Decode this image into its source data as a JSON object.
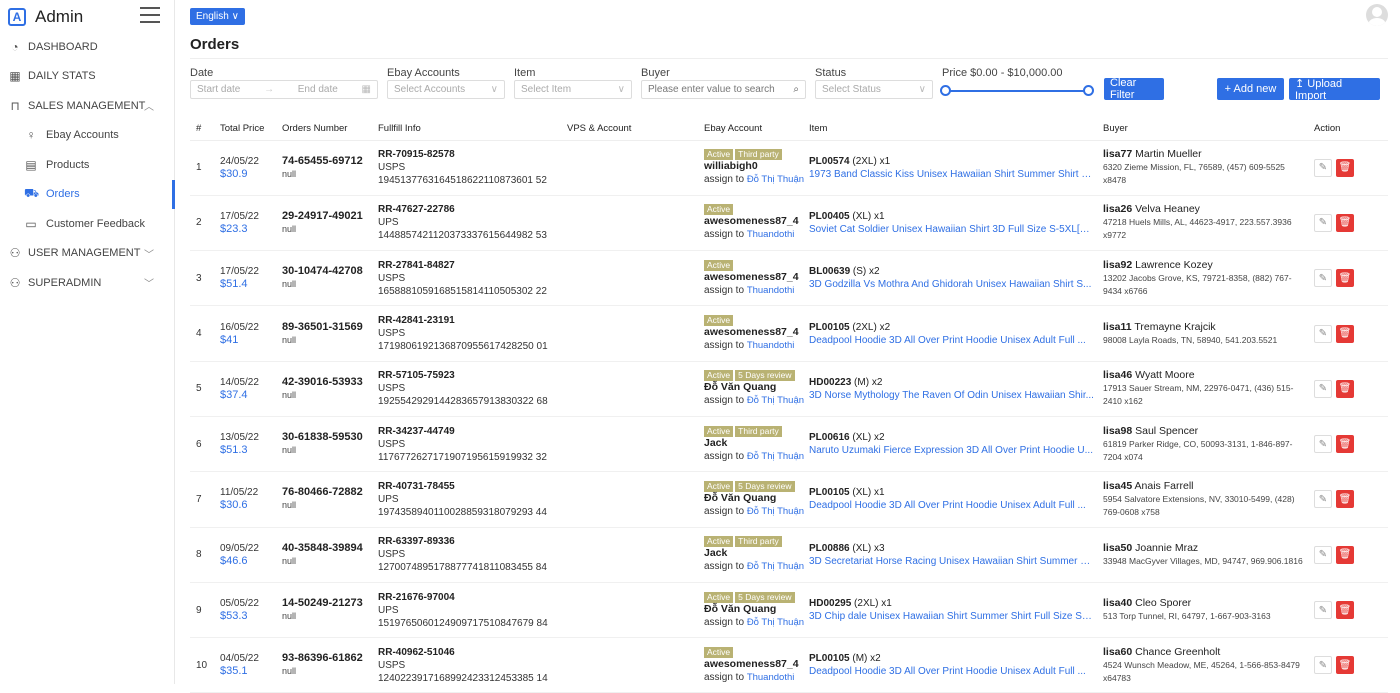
{
  "sidebar": {
    "brand": "Admin",
    "items": [
      {
        "label": "DASHBOARD",
        "icon": "speedometer-icon"
      },
      {
        "label": "DAILY STATS",
        "icon": "calendar-icon"
      },
      {
        "label": "SALES MANAGEMENT",
        "icon": "bag-icon"
      },
      {
        "label": "Ebay Accounts",
        "icon": "person-icon"
      },
      {
        "label": "Products",
        "icon": "products-icon"
      },
      {
        "label": "Orders",
        "icon": "cart-icon"
      },
      {
        "label": "Customer Feedback",
        "icon": "feedback-icon"
      },
      {
        "label": "USER MANAGEMENT",
        "icon": "users-icon"
      },
      {
        "label": "SUPERADMIN",
        "icon": "admin-icon"
      }
    ]
  },
  "header": {
    "language": "English ∨"
  },
  "page": {
    "title": "Orders"
  },
  "filters": {
    "date_label": "Date",
    "start_placeholder": "Start date",
    "end_placeholder": "End date",
    "accounts_label": "Ebay Accounts",
    "accounts_placeholder": "Select Accounts",
    "item_label": "Item",
    "item_placeholder": "Select Item",
    "buyer_label": "Buyer",
    "buyer_placeholder": "Please enter value to search",
    "status_label": "Status",
    "status_placeholder": "Select Status",
    "price_label": "Price",
    "price_range": "$0.00 - $10,000.00",
    "clear_label": "Clear Filter",
    "add_label": "+ Add new",
    "upload_label": "↥ Upload Import"
  },
  "table": {
    "headers": [
      "#",
      "Total Price",
      "Orders Number",
      "Fullfill Info",
      "VPS & Account",
      "Ebay Account",
      "Item",
      "Buyer",
      "Action"
    ],
    "rows": [
      {
        "idx": "1",
        "date": "24/05/22",
        "price": "$30.9",
        "order": "74-65455-69712",
        "null": "null",
        "track": "RR-70915-82578",
        "carrier": "USPS",
        "code": "1945137763164518622110873601 52",
        "badges": [
          "Active",
          "Third party"
        ],
        "account": "williabigh0",
        "assign_prefix": "assign to",
        "assignee": "Đỗ Thị Thuận",
        "sku": "PL00574",
        "size": "(2XL) x1",
        "item": "1973 Band Classic Kiss Unisex Hawaiian Shirt Summer Shirt Fu...",
        "buyer_id": "lisa77",
        "buyer_name": "Martin Mueller",
        "address": "6320 Zieme Mission, FL, 76589, (457) 609-5525 x8478"
      },
      {
        "idx": "2",
        "date": "17/05/22",
        "price": "$23.3",
        "order": "29-24917-49021",
        "null": "null",
        "track": "RR-47627-22786",
        "carrier": "UPS",
        "code": "1448857421120373337615644982 53",
        "badges": [
          "Active"
        ],
        "account": "awesomeness87_4",
        "assign_prefix": "assign to",
        "assignee": "Thuandothi",
        "sku": "PL00405",
        "size": "(XL) x1",
        "item": "Soviet Cat Soldier Unisex Hawaiian Shirt 3D Full Size S-5XL[XL...",
        "buyer_id": "lisa26",
        "buyer_name": "Velva Heaney",
        "address": "47218 Huels Mills, AL, 44623-4917, 223.557.3936 x9772"
      },
      {
        "idx": "3",
        "date": "17/05/22",
        "price": "$51.4",
        "order": "30-10474-42708",
        "null": "null",
        "track": "RR-27841-84827",
        "carrier": "USPS",
        "code": "1658881059168515814110505302 22",
        "badges": [
          "Active"
        ],
        "account": "awesomeness87_4",
        "assign_prefix": "assign to",
        "assignee": "Thuandothi",
        "sku": "BL00639",
        "size": "(S) x2",
        "item": "3D Godzilla Vs Mothra And Ghidorah Unisex Hawaiian Shirt S...",
        "buyer_id": "lisa92",
        "buyer_name": "Lawrence Kozey",
        "address": "13202 Jacobs Grove, KS, 79721-8358, (882) 767-9434 x6766"
      },
      {
        "idx": "4",
        "date": "16/05/22",
        "price": "$41",
        "order": "89-36501-31569",
        "null": "null",
        "track": "RR-42841-23191",
        "carrier": "USPS",
        "code": "1719806192136870955617428250 01",
        "badges": [
          "Active"
        ],
        "account": "awesomeness87_4",
        "assign_prefix": "assign to",
        "assignee": "Thuandothi",
        "sku": "PL00105",
        "size": "(2XL) x2",
        "item": "Deadpool Hoodie 3D All Over Print Hoodie Unisex Adult Full ...",
        "buyer_id": "lisa11",
        "buyer_name": "Tremayne Krajcik",
        "address": "98008 Layla Roads, TN, 58940, 541.203.5521"
      },
      {
        "idx": "5",
        "date": "14/05/22",
        "price": "$37.4",
        "order": "42-39016-53933",
        "null": "null",
        "track": "RR-57105-75923",
        "carrier": "USPS",
        "code": "1925542929144283657913830322 68",
        "badges": [
          "Active",
          "5 Days review"
        ],
        "account": "Đỗ Văn Quang",
        "assign_prefix": "assign to",
        "assignee": "Đỗ Thị Thuận",
        "sku": "HD00223",
        "size": "(M) x2",
        "item": "3D Norse Mythology The Raven Of Odin Unisex Hawaiian Shir...",
        "buyer_id": "lisa46",
        "buyer_name": "Wyatt Moore",
        "address": "17913 Sauer Stream, NM, 22976-0471, (436) 515-2410 x162"
      },
      {
        "idx": "6",
        "date": "13/05/22",
        "price": "$51.3",
        "order": "30-61838-59530",
        "null": "null",
        "track": "RR-34237-44749",
        "carrier": "USPS",
        "code": "1176772627171907195615919932 32",
        "badges": [
          "Active",
          "Third party"
        ],
        "account": "Jack",
        "assign_prefix": "assign to",
        "assignee": "Đỗ Thị Thuận",
        "sku": "PL00616",
        "size": "(XL) x2",
        "item": "Naruto Uzumaki Fierce Expression 3D All Over Print Hoodie U...",
        "buyer_id": "lisa98",
        "buyer_name": "Saul Spencer",
        "address": "61819 Parker Ridge, CO, 50093-3131, 1-846-897-7204 x074"
      },
      {
        "idx": "7",
        "date": "11/05/22",
        "price": "$30.6",
        "order": "76-80466-72882",
        "null": "null",
        "track": "RR-40731-78455",
        "carrier": "UPS",
        "code": "1974358940110028859318079293 44",
        "badges": [
          "Active",
          "5 Days review"
        ],
        "account": "Đỗ Văn Quang",
        "assign_prefix": "assign to",
        "assignee": "Đỗ Thị Thuận",
        "sku": "PL00105",
        "size": "(XL) x1",
        "item": "Deadpool Hoodie 3D All Over Print Hoodie Unisex Adult Full ...",
        "buyer_id": "lisa45",
        "buyer_name": "Anais Farrell",
        "address": "5954 Salvatore Extensions, NV, 33010-5499, (428) 769-0608 x758"
      },
      {
        "idx": "8",
        "date": "09/05/22",
        "price": "$46.6",
        "order": "40-35848-39894",
        "null": "null",
        "track": "RR-63397-89336",
        "carrier": "USPS",
        "code": "1270074895178877741811083455 84",
        "badges": [
          "Active",
          "Third party"
        ],
        "account": "Jack",
        "assign_prefix": "assign to",
        "assignee": "Đỗ Thị Thuận",
        "sku": "PL00886",
        "size": "(XL) x3",
        "item": "3D Secretariat Horse Racing Unisex Hawaiian Shirt Summer S...",
        "buyer_id": "lisa50",
        "buyer_name": "Joannie Mraz",
        "address": "33948 MacGyver Villages, MD, 94747, 969.906.1816"
      },
      {
        "idx": "9",
        "date": "05/05/22",
        "price": "$53.3",
        "order": "14-50249-21273",
        "null": "null",
        "track": "RR-21676-97004",
        "carrier": "UPS",
        "code": "1519765060124909717510847679 84",
        "badges": [
          "Active",
          "5 Days review"
        ],
        "account": "Đỗ Văn Quang",
        "assign_prefix": "assign to",
        "assignee": "Đỗ Thị Thuận",
        "sku": "HD00295",
        "size": "(2XL) x1",
        "item": "3D Chip dale Unisex Hawaiian Shirt Summer Shirt Full Size S-5...",
        "buyer_id": "lisa40",
        "buyer_name": "Cleo Sporer",
        "address": "513 Torp Tunnel, RI, 64797, 1-667-903-3163"
      },
      {
        "idx": "10",
        "date": "04/05/22",
        "price": "$35.1",
        "order": "93-86396-61862",
        "null": "null",
        "track": "RR-40962-51046",
        "carrier": "USPS",
        "code": "1240223917168992423312453385 14",
        "badges": [
          "Active"
        ],
        "account": "awesomeness87_4",
        "assign_prefix": "assign to",
        "assignee": "Thuandothi",
        "sku": "PL00105",
        "size": "(M) x2",
        "item": "Deadpool Hoodie 3D All Over Print Hoodie Unisex Adult Full ...",
        "buyer_id": "lisa60",
        "buyer_name": "Chance Greenholt",
        "address": "4524 Wunsch Meadow, ME, 45264, 1-566-853-8479 x64783"
      }
    ]
  },
  "colors": {
    "accent": "#2f6fe4",
    "badge": "#b9b273",
    "delete": "#e53935"
  }
}
